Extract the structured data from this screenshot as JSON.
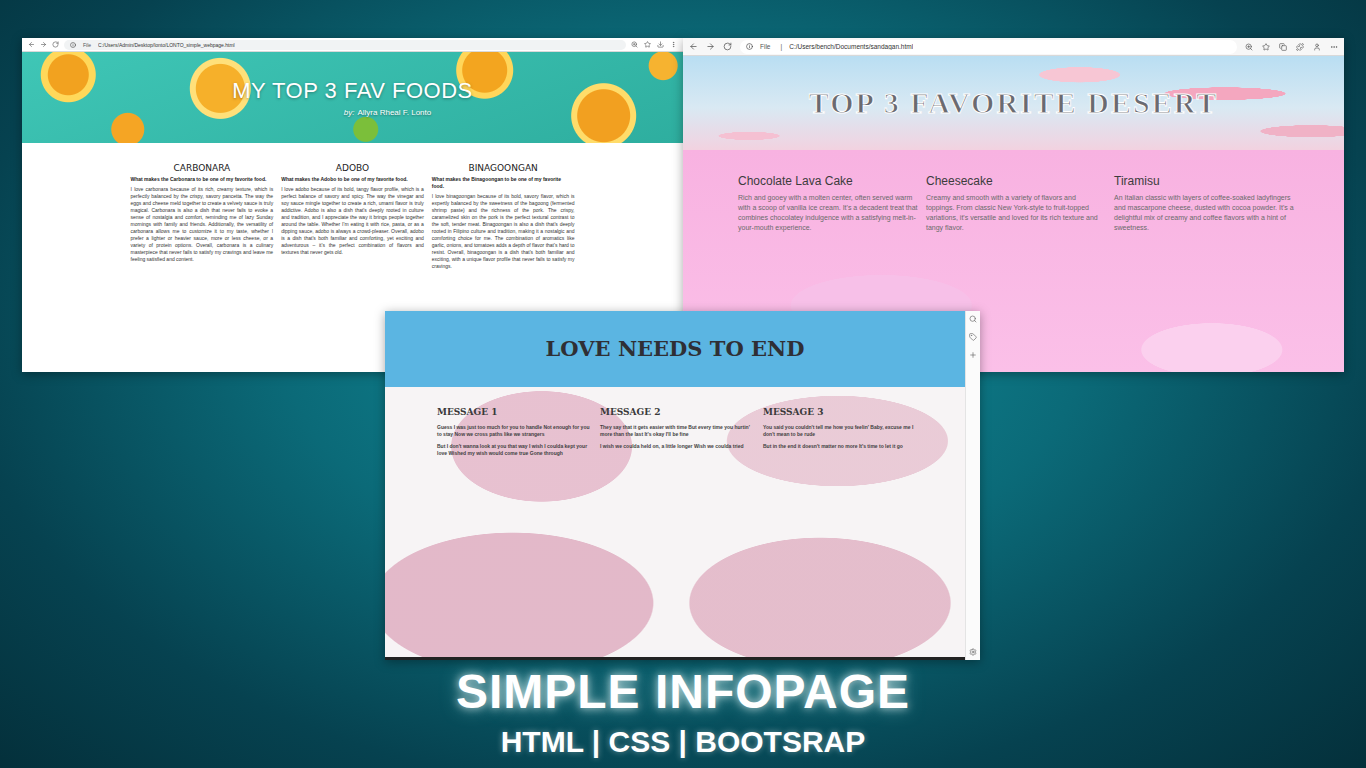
{
  "food_page": {
    "browser": {
      "scheme": "File",
      "url": "C:/Users/Admin/Desktop/lonto/LONTO_simple_webpage.html"
    },
    "title": "MY TOP 3 FAV FOODS",
    "byline_prefix": "by:",
    "author": "Allyra Rheal F. Lonto",
    "columns": [
      {
        "heading": "CARBONARA",
        "subtitle": "What makes the Carbonara to be one of my favorite food.",
        "text": "I love carbonara because of its rich, creamy texture, which is perfectly balanced by the crispy, savory pancetta. The way the eggs and cheese meld together to create a velvety sauce is truly magical. Carbonara is also a dish that never fails to evoke a sense of nostalgia and comfort, reminding me of lazy Sunday mornings with family and friends. Additionally, the versatility of carbonara allows me to customize it to my taste, whether I prefer a lighter or heavier sauce, more or less cheese, or a variety of protein options. Overall, carbonara is a culinary masterpiece that never fails to satisfy my cravings and leave me feeling satisfied and content."
      },
      {
        "heading": "ADOBO",
        "subtitle": "What makes the Adobo to be one of my favorite food.",
        "text": "I love adobo because of its bold, tangy flavor profile, which is a perfect balance of savory and spicy. The way the vinegar and soy sauce mingle together to create a rich, umami flavor is truly addictive. Adobo is also a dish that's deeply rooted in culture and tradition, and I appreciate the way it brings people together around the table. Whether I'm eating it with rice, pasta, or as a dipping sauce, adobo is always a crowd-pleaser. Overall, adobo is a dish that's both familiar and comforting, yet exciting and adventurous – it's the perfect combination of flavors and textures that never gets old."
      },
      {
        "heading": "BINAGOONGAN",
        "subtitle": "What makes the Binagoongan to be one of my favorite food.",
        "text": "I love binagoongan because of its bold, savory flavor, which is expertly balanced by the sweetness of the bagoong (fermented shrimp paste) and the richness of the pork. The crispy, caramelized skin on the pork is the perfect textural contrast to the soft, tender meat. Binagoongan is also a dish that's deeply rooted in Filipino culture and tradition, making it a nostalgic and comforting choice for me. The combination of aromatics like garlic, onions, and tomatoes adds a depth of flavor that's hard to resist. Overall, binagoongan is a dish that's both familiar and exciting, with a unique flavor profile that never fails to satisfy my cravings."
      }
    ]
  },
  "dessert_page": {
    "browser": {
      "scheme": "File",
      "separator": "|",
      "url": "C:/Users/bench/Documents/sandagan.html"
    },
    "title": "TOP 3 FAVORITE DESERT",
    "columns": [
      {
        "heading": "Chocolate Lava Cake",
        "text": "Rich and gooey with a molten center, often served warm with a scoop of vanilla ice cream. It's a decadent treat that combines chocolatey indulgence with a satisfying melt-in-your-mouth experience."
      },
      {
        "heading": "Cheesecake",
        "text": "Creamy and smooth with a variety of flavors and toppings. From classic New York-style to fruit-topped variations, it's versatile and loved for its rich texture and tangy flavor."
      },
      {
        "heading": "Tiramisu",
        "text": "An Italian classic with layers of coffee-soaked ladyfingers and mascarpone cheese, dusted with cocoa powder. It's a delightful mix of creamy and coffee flavors with a hint of sweetness."
      }
    ]
  },
  "message_page": {
    "title": "LOVE NEEDS TO END",
    "columns": [
      {
        "heading": "MESSAGE 1",
        "lines": [
          "Guess I was just too much for you to handle Not enough for you to stay Now we cross paths like we strangers",
          "But I don't wanna look at you that way I wish I coulda kept your love Wished my wish would come true Gone through"
        ]
      },
      {
        "heading": "MESSAGE 2",
        "lines": [
          "They say that it gets easier with time But every time you hurtin' more than the last It's okay I'll be fine",
          "I wish we coulda held on, a little longer Wish we coulda tried"
        ]
      },
      {
        "heading": "MESSAGE 3",
        "lines": [
          "You said you couldn't tell me how you feelin' Baby, excuse me I don't mean to be rude",
          "But in the end it doesn't matter no more It's time to let it go"
        ]
      }
    ]
  },
  "caption": {
    "title": "SIMPLE INFOPAGE",
    "subtitle": "HTML | CSS | BOOTSRAP"
  }
}
